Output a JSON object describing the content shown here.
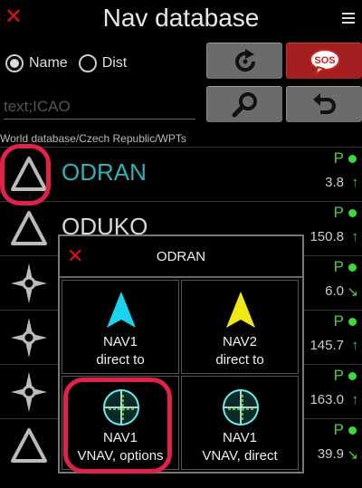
{
  "header": {
    "title": "Nav database",
    "close_icon": "close-icon",
    "menu_icon": "menu-icon"
  },
  "sort": {
    "name_label": "Name",
    "dist_label": "Dist",
    "selected": "Name"
  },
  "search": {
    "placeholder": "text;ICAO",
    "value": ""
  },
  "buttons": {
    "refresh_icon": "refresh-icon",
    "sos_label": "SOS",
    "search_icon": "magnifier-icon",
    "back_icon": "back-icon"
  },
  "path": "World database/Czech Republic/WPTs",
  "list": [
    {
      "name": "ODRAN",
      "type": "triangle",
      "flag": "P",
      "dist": "3.8",
      "arrow": "↑",
      "selected": true
    },
    {
      "name": "ODUKO",
      "type": "triangle",
      "flag": "P",
      "dist": "150.8",
      "arrow": "↑"
    },
    {
      "name": "",
      "type": "star",
      "flag": "P",
      "dist": "6.0",
      "arrow": "↘"
    },
    {
      "name": "",
      "type": "star",
      "flag": "P",
      "dist": "145.7",
      "arrow": "↑"
    },
    {
      "name": "",
      "type": "star",
      "flag": "P",
      "dist": "163.0",
      "arrow": "↑"
    },
    {
      "name": "",
      "type": "triangle",
      "flag": "P",
      "dist": "39.9",
      "arrow": "↘"
    }
  ],
  "dialog": {
    "title": "ODRAN",
    "options": [
      {
        "line1": "NAV1",
        "line2": "direct to",
        "icon": "cyan-arrow-icon",
        "color": "#19d4ee"
      },
      {
        "line1": "NAV2",
        "line2": "direct to",
        "icon": "yellow-arrow-icon",
        "color": "#f0e814"
      },
      {
        "line1": "NAV1",
        "line2": "VNAV, options",
        "icon": "crosshair-icon",
        "highlighted": true
      },
      {
        "line1": "NAV1",
        "line2": "VNAV, direct",
        "icon": "crosshair-icon"
      }
    ]
  },
  "colors": {
    "highlight": "#e0224a",
    "selected_name": "#2db3b3",
    "gps_ok": "#3dd83d",
    "sos": "#a31e1e"
  }
}
